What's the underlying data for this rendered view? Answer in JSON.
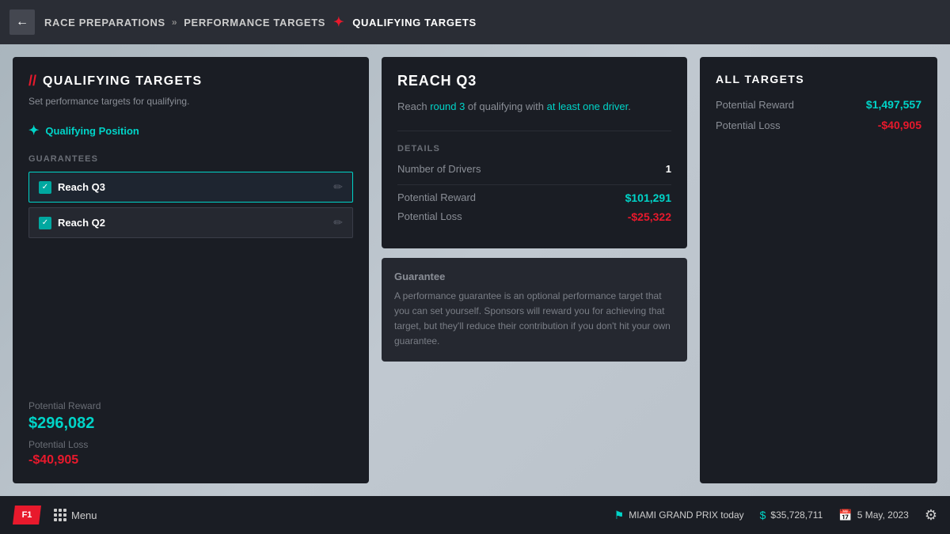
{
  "nav": {
    "back_label": "←",
    "breadcrumb": [
      {
        "text": "RACE PREPARATIONS",
        "active": false
      },
      {
        "sep": "»"
      },
      {
        "text": "PERFORMANCE TARGETS",
        "active": false
      },
      {
        "sep": "❯"
      },
      {
        "text": "QUALIFYING TARGETS",
        "active": true
      }
    ]
  },
  "left_panel": {
    "title": "QUALIFYING TARGETS",
    "subtitle": "Set performance targets for qualifying.",
    "qualifying_position_label": "Qualifying Position",
    "guarantees_label": "GUARANTEES",
    "guarantees": [
      {
        "id": "q3",
        "name": "Reach Q3",
        "checked": true
      },
      {
        "id": "q2",
        "name": "Reach Q2",
        "checked": true
      }
    ],
    "potential_reward_label": "Potential Reward",
    "potential_reward_value": "$296,082",
    "potential_loss_label": "Potential Loss",
    "potential_loss_value": "-$40,905"
  },
  "middle_panel": {
    "card_title": "REACH Q3",
    "card_description_pre": "Reach ",
    "card_description_round": "round 3",
    "card_description_mid": " of qualifying with ",
    "card_description_drivers": "at least one driver",
    "card_description_post": ".",
    "details_label": "DETAILS",
    "number_of_drivers_label": "Number of Drivers",
    "number_of_drivers_value": "1",
    "potential_reward_label": "Potential Reward",
    "potential_reward_value": "$101,291",
    "potential_loss_label": "Potential Loss",
    "potential_loss_value": "-$25,322",
    "guarantee_info_title": "Guarantee",
    "guarantee_info_text": "A performance guarantee is an optional performance target that you can set yourself. Sponsors will reward you for achieving that target, but they'll reduce their contribution if you don't hit your own guarantee."
  },
  "right_panel": {
    "title": "ALL TARGETS",
    "potential_reward_label": "Potential Reward",
    "potential_reward_value": "$1,497,557",
    "potential_loss_label": "Potential Loss",
    "potential_loss_value": "-$40,905"
  },
  "bottom_bar": {
    "f1_logo": "F1",
    "menu_label": "Menu",
    "event_label": "MIAMI GRAND PRIX today",
    "balance_label": "$35,728,711",
    "date_label": "5 May, 2023"
  }
}
